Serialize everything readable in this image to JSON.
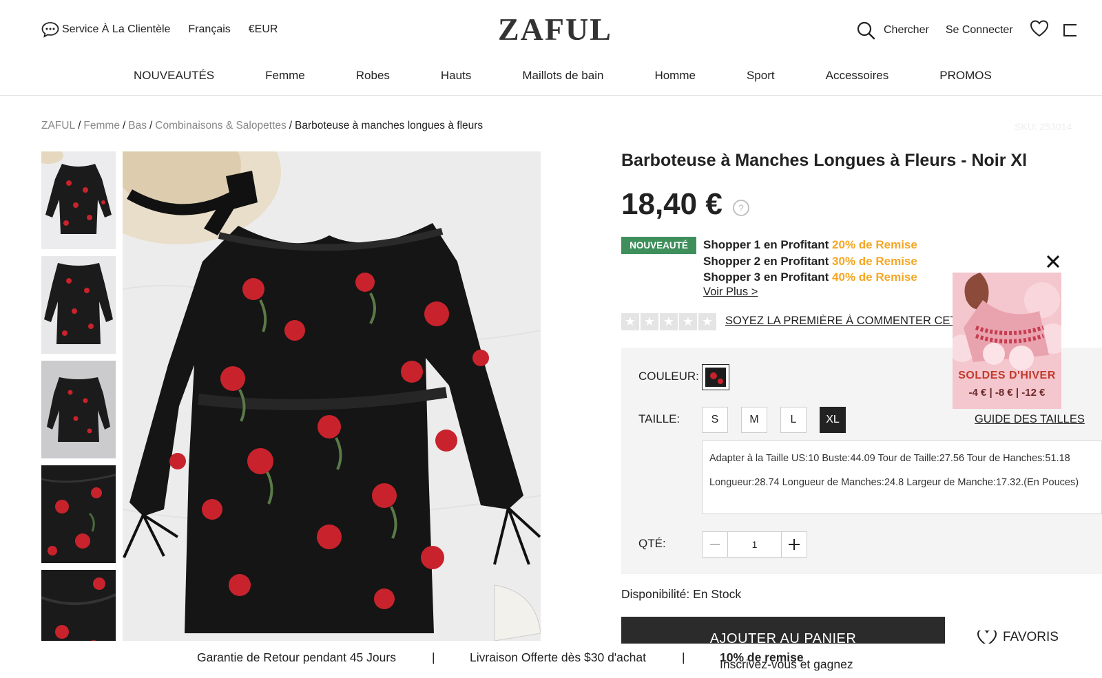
{
  "header": {
    "customer_service": "Service À La Clientèle",
    "language": "Français",
    "currency": "€EUR",
    "logo": "ZAFUL",
    "search_label": "Chercher",
    "login_label": "Se Connecter"
  },
  "nav": {
    "items": [
      "NOUVEAUTÉS",
      "Femme",
      "Robes",
      "Hauts",
      "Maillots de bain",
      "Homme",
      "Sport",
      "Accessoires",
      "PROMOS"
    ]
  },
  "breadcrumb": {
    "items": [
      "ZAFUL",
      "Femme",
      "Bas",
      "Combinaisons & Salopettes"
    ],
    "current": "Barboteuse à manches longues à fleurs",
    "separator": "/",
    "sku": "SKU: 253014"
  },
  "product": {
    "title": "Barboteuse à Manches Longues à Fleurs - Noir Xl",
    "price": "18,40 €",
    "badge": "NOUVEAUTÉ",
    "promos": [
      {
        "prefix": "Shopper 1 en Profitant ",
        "discount": "20% de Remise"
      },
      {
        "prefix": "Shopper 2 en Profitant ",
        "discount": "30% de Remise"
      },
      {
        "prefix": "Shopper 3 en Profitant ",
        "discount": "40% de Remise"
      }
    ],
    "see_more": "Voir Plus >",
    "rating_stars": 0,
    "review_link": "SOYEZ LA PREMIÈRE À COMMENTER CET",
    "color_label": "COULEUR:",
    "size_label": "TAILLE:",
    "sizes": [
      "S",
      "M",
      "L",
      "XL"
    ],
    "selected_size": "XL",
    "size_guide": "GUIDE DES TAILLES",
    "size_info": "Adapter à la Taille US:10   Buste:44.09   Tour de Taille:27.56   Tour de Hanches:51.18   Longueur:28.74   Longueur de Manches:24.8   Largeur de Manche:17.32.(En Pouces)",
    "qty_label": "QTÉ:",
    "qty_value": "1",
    "availability": "Disponibilité: En Stock",
    "add_to_cart": "AJOUTER AU PANIER",
    "favorites": "FAVORIS"
  },
  "ad": {
    "title": "SOLDES D'HIVER",
    "subtitle": "-4 € | -8 € | -12 €"
  },
  "footer_strip": {
    "guarantee": "Garantie de Retour pendant 45 Jours",
    "shipping": "Livraison Offerte dès $30 d'achat",
    "signup_prefix": "Inscrivez-vous et gagnez ",
    "signup_bold": "10% de remise",
    "separator": "|"
  },
  "colors": {
    "badge_green": "#3f8f5c",
    "discount_orange": "#f5a623",
    "ad_red": "#c0392b"
  }
}
